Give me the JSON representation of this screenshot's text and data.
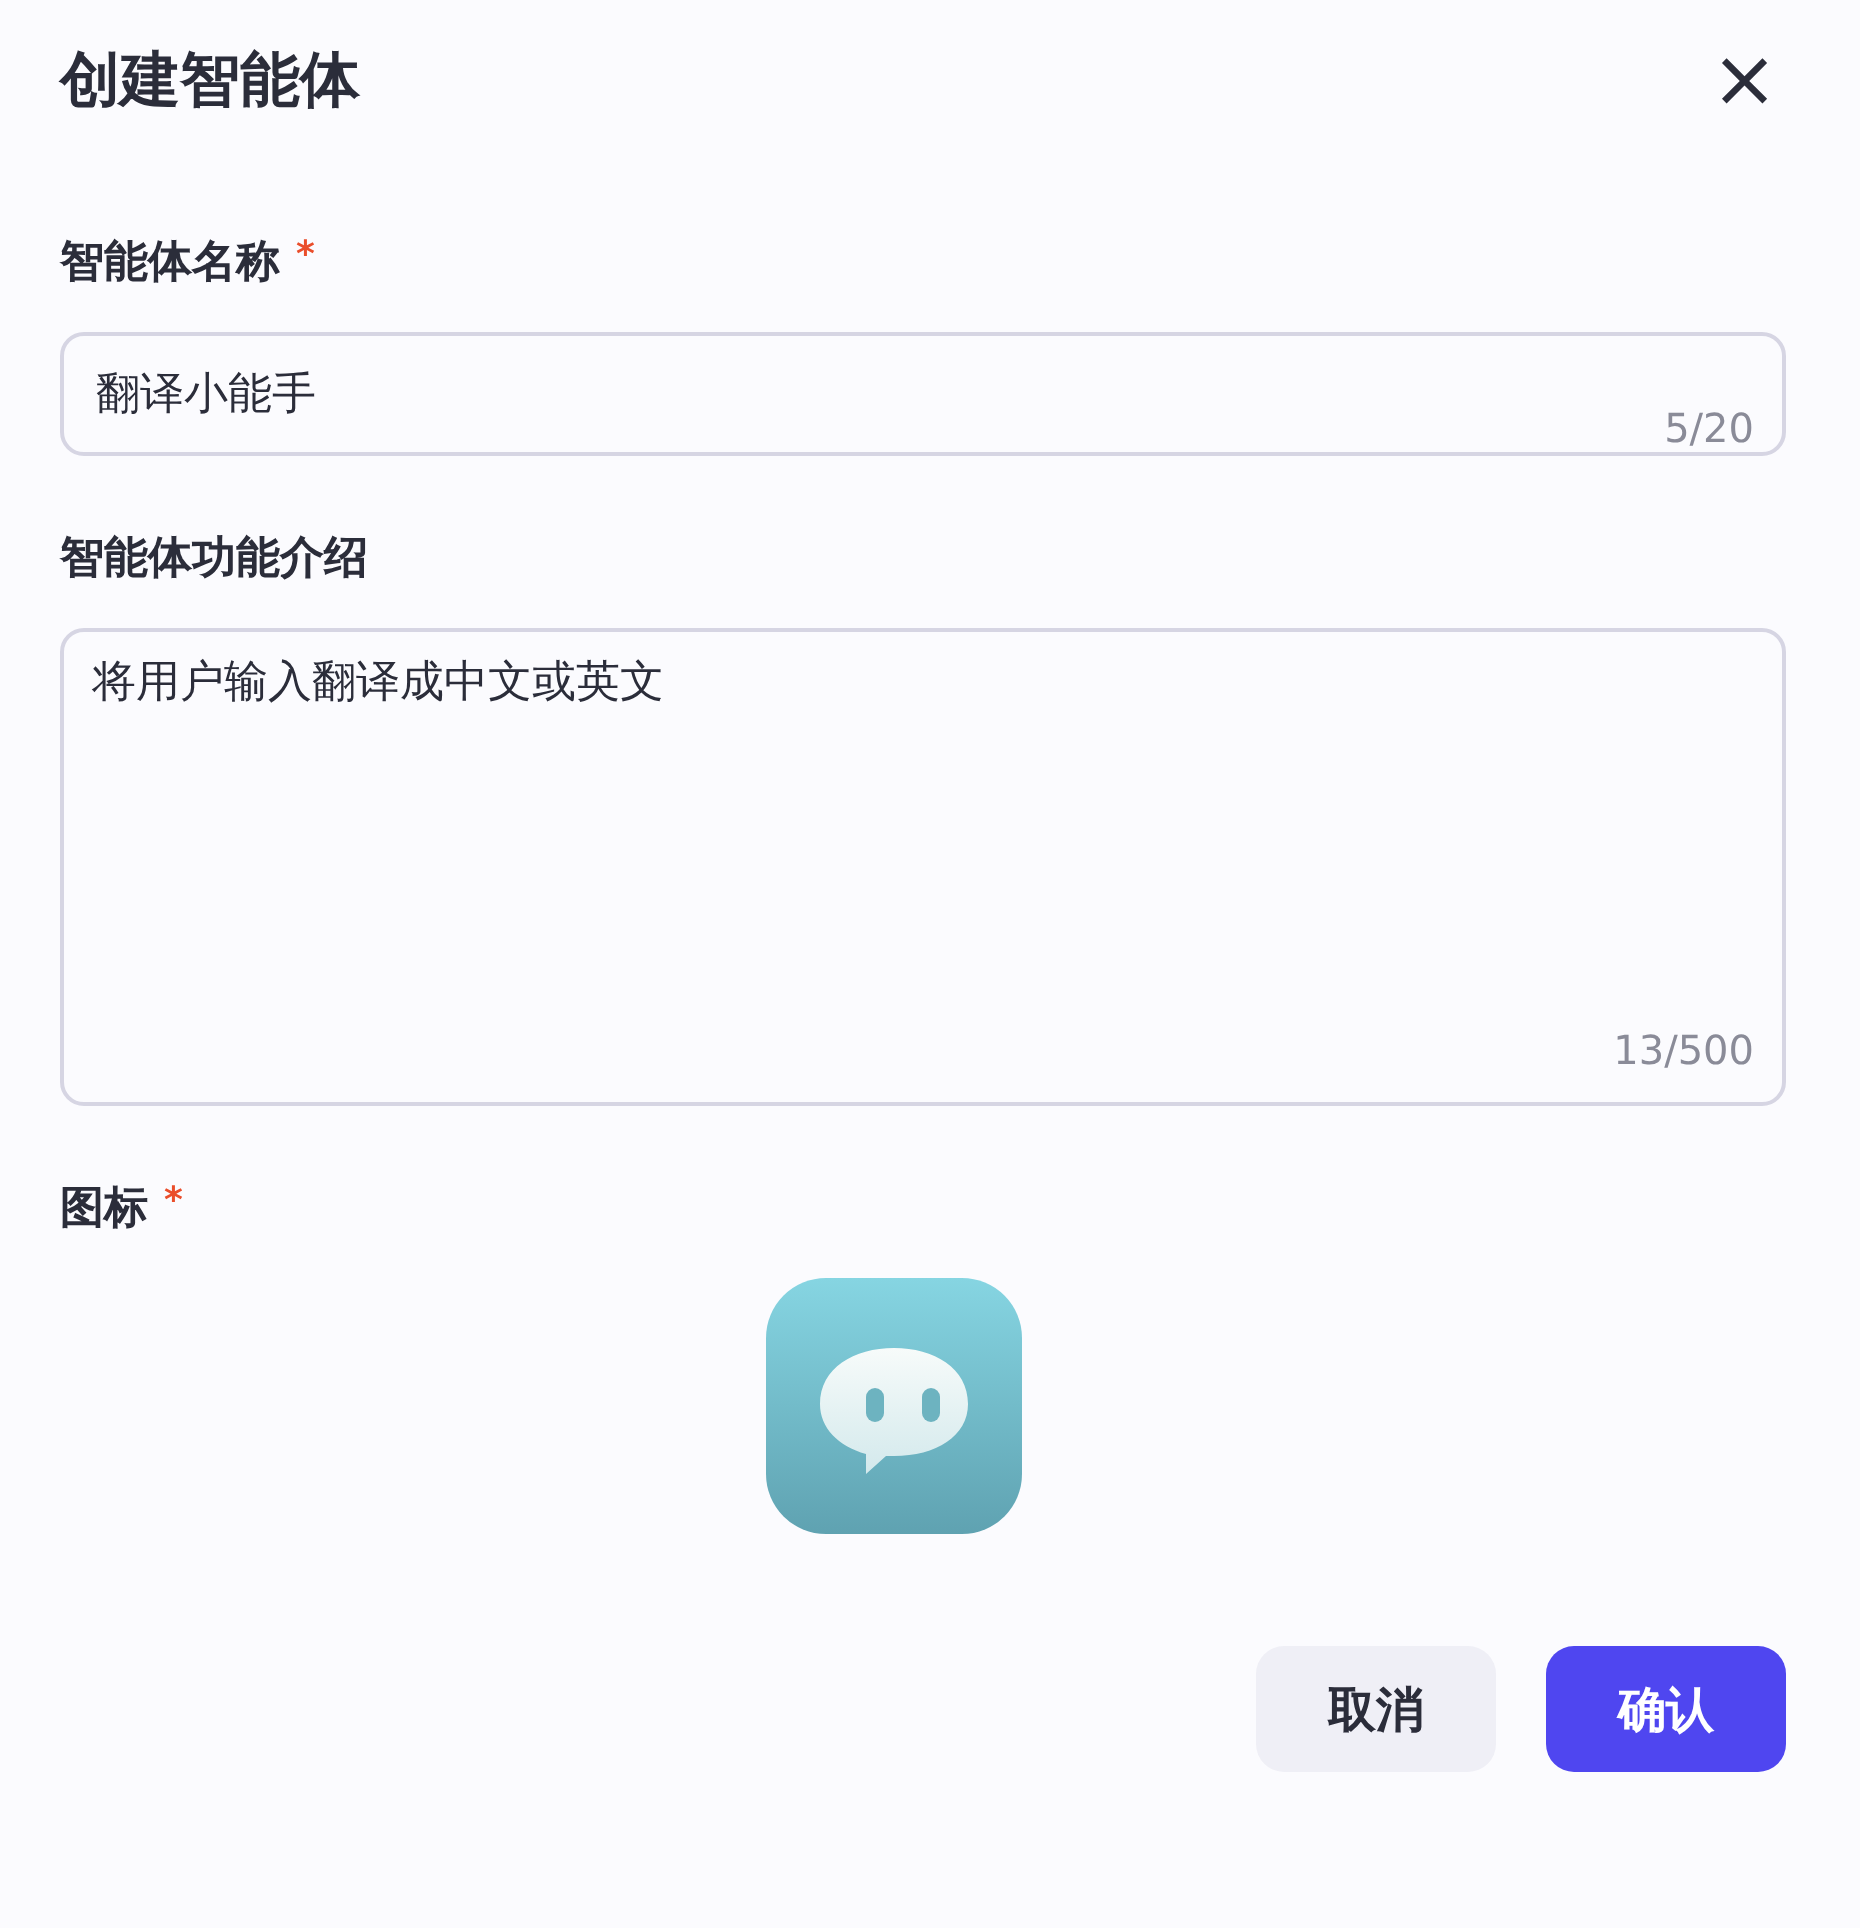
{
  "dialog": {
    "title": "创建智能体",
    "close": "×"
  },
  "fields": [
    {
      "kind": "input",
      "label": "智能体名称",
      "required_mark": "*",
      "value": "翻译小能手",
      "counter": "5/20"
    },
    {
      "kind": "textarea",
      "label": "智能体功能介绍",
      "value": "将用户输入翻译成中文或英文",
      "counter": "13/500"
    },
    {
      "kind": "icon",
      "label": "图标",
      "required_mark": "*"
    }
  ],
  "buttons": [
    {
      "label": "取消",
      "kind": "secondary"
    },
    {
      "label": "确认",
      "kind": "primary"
    }
  ]
}
